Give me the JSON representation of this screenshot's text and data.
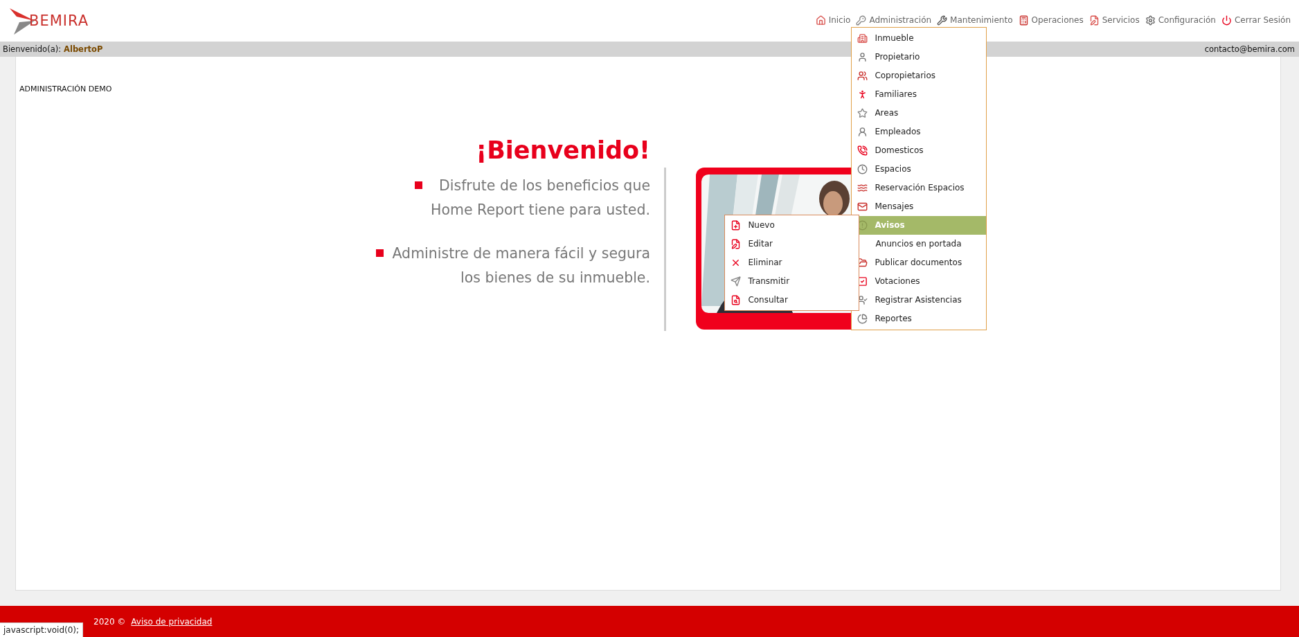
{
  "header": {
    "logo": "BEMIRA",
    "nav": [
      {
        "label": "Inicio",
        "expanded": false
      },
      {
        "label": "Administración",
        "expanded": true
      },
      {
        "label": "Mantenimiento",
        "expanded": false
      },
      {
        "label": "Operaciones",
        "expanded": false
      },
      {
        "label": "Servicios",
        "expanded": false
      },
      {
        "label": "Configuración",
        "expanded": false
      },
      {
        "label": "Cerrar Sesión",
        "expanded": false
      }
    ]
  },
  "admin_menu": [
    {
      "label": "Inmueble",
      "selected": false
    },
    {
      "label": "Propietario",
      "selected": false
    },
    {
      "label": "Copropietarios",
      "selected": false
    },
    {
      "label": "Familiares",
      "selected": false
    },
    {
      "label": "Areas",
      "selected": false
    },
    {
      "label": "Empleados",
      "selected": false
    },
    {
      "label": "Domesticos",
      "selected": false
    },
    {
      "label": "Espacios",
      "selected": false
    },
    {
      "label": "Reservación Espacios",
      "selected": false
    },
    {
      "label": "Mensajes",
      "selected": false
    },
    {
      "label": "Avisos",
      "selected": true,
      "children": [
        {
          "label": "Nuevo"
        },
        {
          "label": "Editar"
        },
        {
          "label": "Eliminar"
        },
        {
          "label": "Transmitir"
        },
        {
          "label": "Consultar"
        }
      ]
    },
    {
      "label": "Anuncios en portada",
      "selected": false
    },
    {
      "label": "Publicar documentos",
      "selected": false
    },
    {
      "label": "Votaciones",
      "selected": false
    },
    {
      "label": "Registrar Asistencias",
      "selected": false
    },
    {
      "label": "Reportes",
      "selected": false
    }
  ],
  "greeting_bar": {
    "label": "Bienvenido(a):",
    "user": "AlbertoP",
    "email": "contacto@bemira.com"
  },
  "content": {
    "heading": "ADMINISTRACIÓN DEMO",
    "welcome_title": "¡Bienvenido!",
    "bullets": [
      [
        "Disfrute de los beneficios que",
        "Home Report tiene para usted."
      ],
      [
        "Administre de manera fácil y segura",
        "los bienes de su inmueble."
      ]
    ]
  },
  "footer": {
    "text": "2020 ©",
    "link": "Aviso de privacidad"
  },
  "status_tooltip": "javascript:void(0);"
}
